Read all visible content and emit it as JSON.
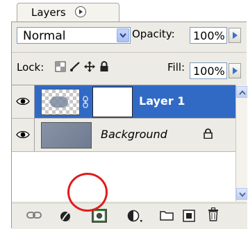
{
  "tab": {
    "title": "Layers"
  },
  "blend": {
    "mode": "Normal"
  },
  "opacity": {
    "label": "Opacity:",
    "value": "100%"
  },
  "lock": {
    "label": "Lock:"
  },
  "fill": {
    "label": "Fill:",
    "value": "100%"
  },
  "layers": [
    {
      "name": "Layer 1",
      "selected": true
    },
    {
      "name": "Background",
      "locked": true
    }
  ],
  "bottom_icons": [
    "link-icon",
    "layer-style-icon",
    "add-mask-icon",
    "adjustment-layer-icon",
    "new-group-icon",
    "new-layer-icon",
    "trash-icon"
  ],
  "colors": {
    "selection": "#316ac5",
    "panel": "#ecebe5",
    "highlight": "#e21b1b"
  }
}
